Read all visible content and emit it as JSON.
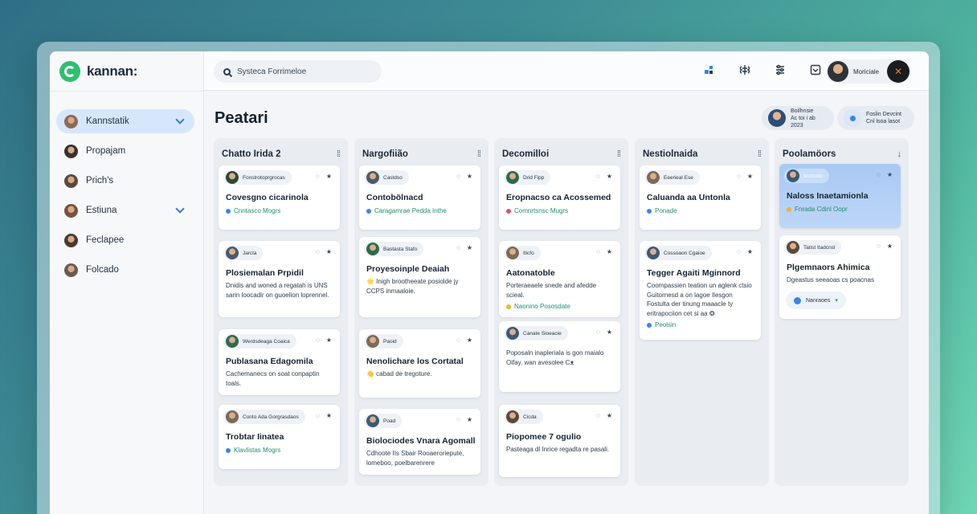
{
  "app": {
    "name": "kannan:"
  },
  "search": {
    "placeholder": "Systeca Forrimeloe"
  },
  "sidebar": {
    "items": [
      {
        "label": "Kannstatik",
        "expandable": true,
        "active": true
      },
      {
        "label": "Propajam",
        "expandable": false
      },
      {
        "label": "Prich's",
        "expandable": false
      },
      {
        "label": "Estiuna",
        "expandable": true
      },
      {
        "label": "Feclapee",
        "expandable": false
      },
      {
        "label": "Folcado",
        "expandable": false
      }
    ]
  },
  "topbar": {
    "icons": [
      "layout-icon",
      "brain-icon",
      "filter-icon",
      "inbox-icon"
    ],
    "user_name": "Moriciale"
  },
  "page": {
    "title": "Peatari",
    "collaborators": [
      {
        "line1": "Boilhnsie",
        "line2": "Ac toi i ab 2023"
      },
      {
        "line1": "Foslin Devcint",
        "line2": "Cnl lsoa lasot"
      }
    ]
  },
  "columns": [
    {
      "title": "Chatto Irida 2",
      "cards": [
        {
          "chip": "Fonstrotoprgrocas",
          "title": "Covesgno cicarinola",
          "tag": "Cnntasco Mogrs",
          "tag_color": "#3a86e0"
        },
        {
          "chip": "Jarcla",
          "title": "Plosiemalan Prpidil",
          "body": "Dnidis and woned a regatah is UNS sarin loocadir on guoelion loprennel."
        },
        {
          "chip": "Werdsdeaga Coaica",
          "title": "Publasana Edagomila",
          "body": "Cachemanecs on soat conpaptin toals."
        },
        {
          "chip": "Conto Ada Gorgrasdaos",
          "title": "Trobtar Iinatea",
          "tag": "Klavlistas Mogrs",
          "tag_color": "#3a86e0"
        }
      ]
    },
    {
      "title": "Nargofiião",
      "cards": [
        {
          "chip": "Castdso",
          "title": "Contobölnacd",
          "tag": "Caragamrae  Pedda Inthe",
          "tag_color": "#3a86e0"
        },
        {
          "chip": "Bastasta Stafo",
          "title": "Proyesoinple Deaiah",
          "body": "🌟 Inigh brootheeate posiolde jy CCPS inmaaloie."
        },
        {
          "chip": "Paoid",
          "title": "Nenolichare los Cortatal",
          "body": "👋 cabad de tregoture."
        },
        {
          "chip": "Poad",
          "title": "Biolociodes Vnara Agomall",
          "body": "Cdhoote IIs Sbair Rooaeroriepute, lomeboo, poelbarenrere"
        }
      ]
    },
    {
      "title": "Decomilloi",
      "cards": [
        {
          "chip": "Drid Fipp",
          "title": "Eropnacso ca Acossemed",
          "tag": "Comnrtsnsc Mugrs",
          "tag_color": "#e0506a"
        },
        {
          "chip": "Iticfo",
          "title": "Aatonatoble",
          "body": "Porteraeaele snede and afedde scieal.",
          "tag": "Naonino   Pososdate",
          "tag_color": "#f0b429"
        },
        {
          "chip": "Canate Sioeacie",
          "title": "",
          "body": "Poposaln inapleriala is gon maialo Oifay. wan avesolee Cᴥ"
        },
        {
          "chip": "Cicda",
          "title": "Piopomee 7 ogulio",
          "body": "Pasteaga dl Inrice regadta re pasali."
        }
      ]
    },
    {
      "title": "Nestiolnaida",
      "cards": [
        {
          "chip": "Eeerieal Ese",
          "title": "Caluanda aa Untonla",
          "tag": "Ponade",
          "tag_color": "#3a86e0"
        },
        {
          "chip": "Cossoaon Cgaioe",
          "title": "Tegger Agaiti Mginnord",
          "body": "Coompassien teation un aglenk ctsio Guitornesd a on lagoe Ilesgon Fostulta der tinung maaacle ty eritrapociion cet si aa ❂",
          "tag": "Peolsin",
          "tag_color": "#3a86e0"
        }
      ]
    },
    {
      "title": "Poolamöors",
      "cards": [
        {
          "chip": "Vornotio",
          "title": "Naloss Inaetamionla",
          "tag": "Fnrada Cdinl Oopr",
          "tag_color": "#f0b429",
          "highlight": true
        },
        {
          "chip": "Tatist Itadcnsl",
          "title": "Plgemnaors Ahimica",
          "body": "Dgeastus seeaoas cs poacnas",
          "pill": "Nanraoes"
        }
      ]
    }
  ]
}
